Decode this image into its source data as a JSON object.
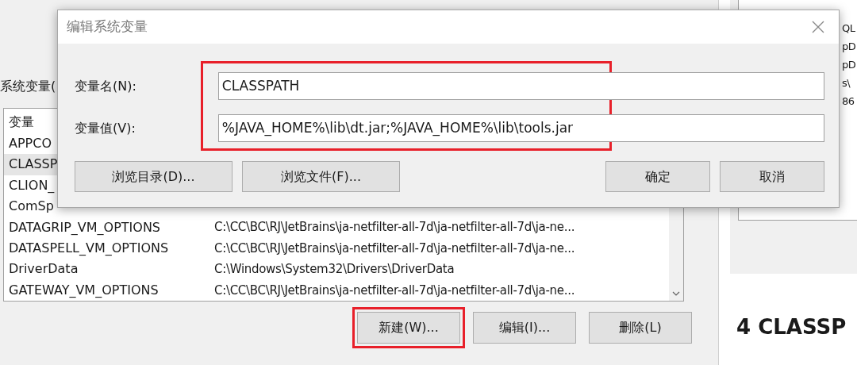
{
  "background_window": {
    "section_label": "系统变量(",
    "list": {
      "column_1": "变量",
      "rows": [
        {
          "name": "APPCO",
          "selected": false
        },
        {
          "name": "CLASSP",
          "selected": true
        },
        {
          "name": "CLION_",
          "selected": false
        },
        {
          "name": "ComSp",
          "selected": false
        },
        {
          "name": "DATAGRIP_VM_OPTIONS",
          "value": "C:\\CC\\BC\\RJ\\JetBrains\\ja-netfilter-all-7d\\ja-netfilter-all-7d\\ja-ne...",
          "selected": false
        },
        {
          "name": "DATASPELL_VM_OPTIONS",
          "value": "C:\\CC\\BC\\RJ\\JetBrains\\ja-netfilter-all-7d\\ja-netfilter-all-7d\\ja-ne...",
          "selected": false
        },
        {
          "name": "DriverData",
          "value": "C:\\Windows\\System32\\Drivers\\DriverData",
          "selected": false
        },
        {
          "name": "GATEWAY_VM_OPTIONS",
          "value": "C:\\CC\\BC\\RJ\\JetBrains\\ja-netfilter-all-7d\\ja-netfilter-all-7d\\ja-ne...",
          "selected": false
        }
      ]
    },
    "buttons": [
      {
        "label": "新建(W)...",
        "highlighted": true
      },
      {
        "label": "编辑(I)...",
        "highlighted": false
      },
      {
        "label": "删除(L)",
        "highlighted": false
      }
    ]
  },
  "side_list": {
    "rows": [
      "QL",
      "pD",
      "pD",
      "s\\",
      "86"
    ]
  },
  "heading": "4 CLASSP",
  "dialog": {
    "title": "编辑系统变量",
    "fields_highlighted": true,
    "fields": [
      {
        "label": "变量名(N):",
        "value": "CLASSPATH"
      },
      {
        "label": "变量值(V):",
        "value": "%JAVA_HOME%\\lib\\dt.jar;%JAVA_HOME%\\lib\\tools.jar"
      }
    ],
    "left_buttons": [
      "浏览目录(D)...",
      "浏览文件(F)..."
    ],
    "right_buttons": [
      "确定",
      "取消"
    ]
  }
}
